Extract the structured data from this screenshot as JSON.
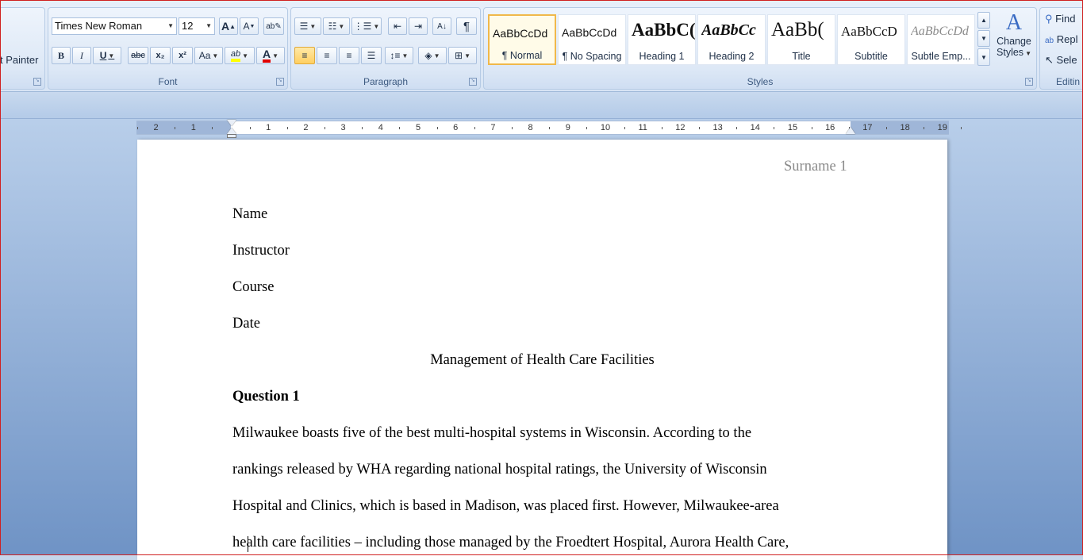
{
  "clipboard": {
    "format_painter_label": "t Painter"
  },
  "font": {
    "group_label": "Font",
    "name": "Times New Roman",
    "size": "12",
    "grow_label": "A",
    "shrink_label": "A",
    "bold": "B",
    "italic": "I",
    "underline": "U",
    "strike": "abc",
    "subscript": "x₂",
    "superscript": "x²",
    "case": "Aa",
    "highlight": "ab",
    "color": "A",
    "highlight_color": "#ffff00",
    "font_color": "#e00000"
  },
  "paragraph": {
    "group_label": "Paragraph",
    "pilcrow": "¶"
  },
  "styles": {
    "group_label": "Styles",
    "items": [
      {
        "sample": "AaBbCcDd",
        "name": "¶ Normal"
      },
      {
        "sample": "AaBbCcDd",
        "name": "¶ No Spacing"
      },
      {
        "sample": "AaBbC(",
        "name": "Heading 1"
      },
      {
        "sample": "AaBbCc",
        "name": "Heading 2"
      },
      {
        "sample": "AaBb(",
        "name": "Title"
      },
      {
        "sample": "AaBbCcD",
        "name": "Subtitle"
      },
      {
        "sample": "AaBbCcDd",
        "name": "Subtle Emp..."
      }
    ],
    "change_styles_line1": "Change",
    "change_styles_line2": "Styles"
  },
  "editing": {
    "group_label": "Editin",
    "find": "Find",
    "replace": "Repl",
    "select": "Sele"
  },
  "ruler": {
    "labels": [
      "2",
      "1",
      "1",
      "2",
      "3",
      "4",
      "5",
      "6",
      "7",
      "8",
      "9",
      "10",
      "11",
      "12",
      "13",
      "14",
      "15",
      "16",
      "17",
      "18",
      "19"
    ]
  },
  "document": {
    "header": "Surname 1",
    "lines": {
      "name": "Name",
      "instructor": "Instructor",
      "course": "Course",
      "date": "Date",
      "title": "Management of Health Care Facilities",
      "question": "Question 1",
      "p1": "Milwaukee boasts five of the best multi-hospital systems in Wisconsin. According to the",
      "p2": "rankings released by WHA regarding national hospital ratings, the University of Wisconsin",
      "p3": "Hospital and Clinics, which is based in Madison, was placed first. However, Milwaukee-area",
      "p4": "health care facilities – including those managed by the Froedtert Hospital, Aurora Health Care,"
    }
  }
}
